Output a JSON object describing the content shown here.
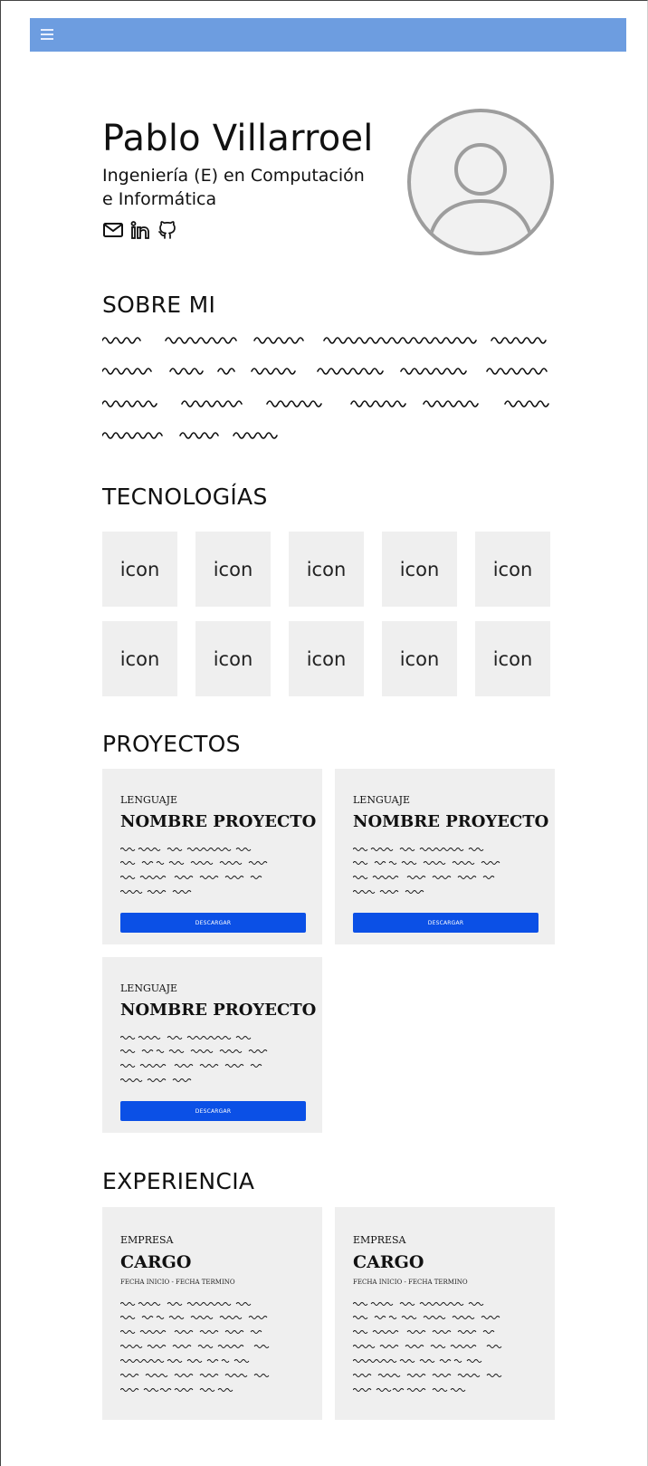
{
  "nav": {
    "menu_icon": "hamburger-menu-icon",
    "bar_color": "#6d9de0"
  },
  "profile": {
    "name": "Pablo Villarroel",
    "subtitle": "Ingeniería (E) en Computación e Informática",
    "icons": [
      "mail-icon",
      "linkedin-icon",
      "github-icon"
    ],
    "avatar_icon": "user-placeholder-icon"
  },
  "about": {
    "title": "SOBRE MI"
  },
  "tech": {
    "title": "TECNOLOGÍAS",
    "tiles": [
      "icon",
      "icon",
      "icon",
      "icon",
      "icon",
      "icon",
      "icon",
      "icon",
      "icon",
      "icon"
    ]
  },
  "projects": {
    "title": "PROYECTOS",
    "items": [
      {
        "language": "LENGUAJE",
        "name": "NOMBRE PROYECTO",
        "button": "DESCARGAR"
      },
      {
        "language": "LENGUAJE",
        "name": "NOMBRE PROYECTO",
        "button": "DESCARGAR"
      },
      {
        "language": "LENGUAJE",
        "name": "NOMBRE PROYECTO",
        "button": "DESCARGAR"
      }
    ]
  },
  "experience": {
    "title": "EXPERIENCIA",
    "items": [
      {
        "company": "EMPRESA",
        "role": "CARGO",
        "dates": "FECHA INICIO - FECHA TERMINO"
      },
      {
        "company": "EMPRESA",
        "role": "CARGO",
        "dates": "FECHA INICIO - FECHA TERMINO"
      }
    ]
  },
  "colors": {
    "button": "#0b50e6",
    "card_bg": "#efefef",
    "tile_bg": "#efefef"
  }
}
